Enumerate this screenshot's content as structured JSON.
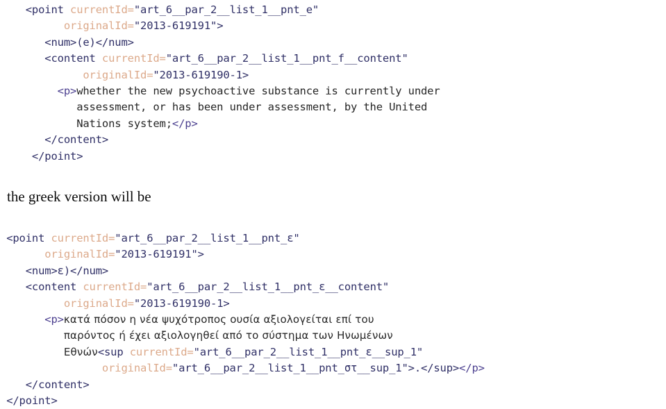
{
  "document": {
    "kind": "xml-source-excerpt",
    "colors": {
      "background": "#ffffff",
      "tag": "#2f2f66",
      "attribute_name": "#dca98a",
      "attribute_value": "#2f2f66",
      "paragraph_tag": "#4b3f8f",
      "body_text": "#262626",
      "prose_text": "#0a0a0a"
    },
    "prose_note": "the greek version will be",
    "english_block": {
      "lines": [
        {
          "indent": "    ",
          "segments": [
            {
              "cls": "tag",
              "t": "<point "
            },
            {
              "cls": "attr",
              "t": "currentId="
            },
            {
              "cls": "val",
              "t": "\"art_6__par_2__list_1__pnt_e\""
            }
          ]
        },
        {
          "indent": "          ",
          "segments": [
            {
              "cls": "attr",
              "t": "originalId="
            },
            {
              "cls": "val",
              "t": "\"2013-619191\">"
            }
          ]
        },
        {
          "indent": "       ",
          "segments": [
            {
              "cls": "tag",
              "t": "<num>(e)</num>"
            }
          ]
        },
        {
          "indent": "       ",
          "segments": [
            {
              "cls": "tag",
              "t": "<content "
            },
            {
              "cls": "attr",
              "t": "currentId="
            },
            {
              "cls": "val",
              "t": "\"art_6__par_2__list_1__pnt_f__content\""
            }
          ]
        },
        {
          "indent": "             ",
          "segments": [
            {
              "cls": "attr",
              "t": "originalId="
            },
            {
              "cls": "val",
              "t": "\"2013-619190-1>"
            }
          ]
        },
        {
          "indent": "         ",
          "segments": [
            {
              "cls": "ptag",
              "t": "<p>"
            },
            {
              "cls": "body",
              "t": "whether the new psychoactive substance is currently under"
            }
          ]
        },
        {
          "indent": "            ",
          "segments": [
            {
              "cls": "body",
              "t": "assessment, or has been under assessment, by the United"
            }
          ]
        },
        {
          "indent": "            ",
          "segments": [
            {
              "cls": "body",
              "t": "Nations system;"
            },
            {
              "cls": "ptag",
              "t": "</p>"
            }
          ]
        },
        {
          "indent": "       ",
          "segments": [
            {
              "cls": "tag",
              "t": "</content>"
            }
          ]
        },
        {
          "indent": "     ",
          "segments": [
            {
              "cls": "tag",
              "t": "</point>"
            }
          ]
        }
      ]
    },
    "greek_block": {
      "lines": [
        {
          "indent": " ",
          "segments": [
            {
              "cls": "tag",
              "t": "<point "
            },
            {
              "cls": "attr",
              "t": "currentId="
            },
            {
              "cls": "val",
              "t": "\"art_6__par_2__list_1__pnt_ε\""
            }
          ]
        },
        {
          "indent": "       ",
          "segments": [
            {
              "cls": "attr",
              "t": "originalId="
            },
            {
              "cls": "val",
              "t": "\"2013-619191\">"
            }
          ]
        },
        {
          "indent": "    ",
          "segments": [
            {
              "cls": "tag",
              "t": "<num>ε)</num>"
            }
          ]
        },
        {
          "indent": "    ",
          "segments": [
            {
              "cls": "tag",
              "t": "<content "
            },
            {
              "cls": "attr",
              "t": "currentId="
            },
            {
              "cls": "val",
              "t": "\"art_6__par_2__list_1__pnt_ε__content\""
            }
          ]
        },
        {
          "indent": "          ",
          "segments": [
            {
              "cls": "attr",
              "t": "originalId="
            },
            {
              "cls": "val",
              "t": "\"2013-619190-1>"
            }
          ]
        },
        {
          "indent": "       ",
          "segments": [
            {
              "cls": "ptag",
              "t": "<p>"
            },
            {
              "cls": "gbody",
              "t": "κατά πόσον η νέα ψυχότροπος ουσία αξιολογείται επί του"
            }
          ]
        },
        {
          "indent": "          ",
          "segments": [
            {
              "cls": "gbody",
              "t": "παρόντος ή έχει αξιολογηθεί από το σύστημα των Ηνωμένων"
            }
          ]
        },
        {
          "indent": "          ",
          "segments": [
            {
              "cls": "gbody",
              "t": "Εθνών"
            },
            {
              "cls": "tag",
              "t": "<sup "
            },
            {
              "cls": "attr",
              "t": "currentId="
            },
            {
              "cls": "val",
              "t": "\"art_6__par_2__list_1__pnt_ε__sup_1\""
            }
          ]
        },
        {
          "indent": "                ",
          "segments": [
            {
              "cls": "attr",
              "t": "originalId="
            },
            {
              "cls": "val",
              "t": "\"art_6__par_2__list_1__pnt_στ__sup_1\">."
            },
            {
              "cls": "tag",
              "t": "</sup>"
            },
            {
              "cls": "ptag",
              "t": "</p>"
            }
          ]
        },
        {
          "indent": "    ",
          "segments": [
            {
              "cls": "tag",
              "t": "</content>"
            }
          ]
        },
        {
          "indent": " ",
          "segments": [
            {
              "cls": "tag",
              "t": "</point>"
            }
          ]
        }
      ]
    }
  }
}
